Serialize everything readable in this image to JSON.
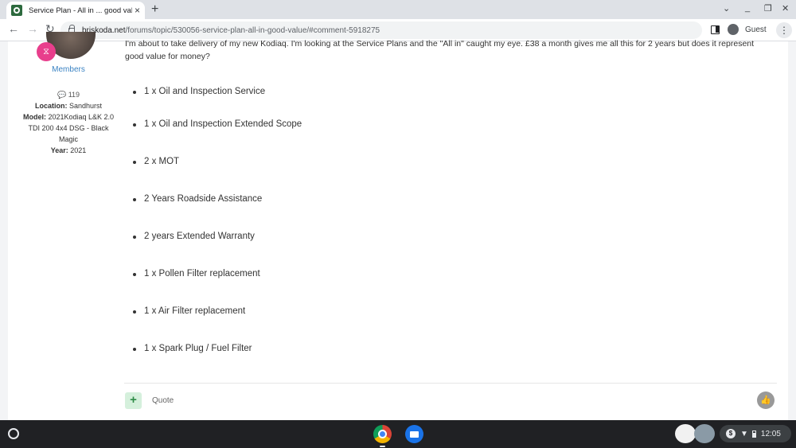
{
  "browser": {
    "tab_title": "Service Plan - All in ... good value",
    "tab_close": "×",
    "new_tab": "+",
    "url_host": "briskoda.net",
    "url_path": "/forums/topic/530056-service-plan-all-in-good-value/#comment-5918275",
    "profile_label": "Guest",
    "menu_glyph": "⋮",
    "win_minimize": "_",
    "win_restore": "❐",
    "win_close": "✕",
    "win_chevron": "⌄"
  },
  "author": {
    "group": "Members",
    "post_count": "119",
    "location_label": "Location:",
    "location": "Sandhurst",
    "model_label": "Model:",
    "model": "2021Kodiaq L&K 2.0 TDI 200 4x4 DSG - Black Magic",
    "year_label": "Year:",
    "year": "2021"
  },
  "post": {
    "intro": "I'm about to take delivery of my new Kodiaq. I'm looking at the Service Plans and the \"All in\" caught my eye. £38 a month gives me all this for 2 years but does it represent good value for money?",
    "items": [
      "1 x Oil and Inspection Service",
      "1 x Oil and Inspection Extended Scope",
      "2 x MOT",
      "2 Years Roadside Assistance",
      "2 years Extended Warranty",
      "1 x Pollen Filter replacement",
      "1 x Air Filter replacement",
      "1 x Spark Plug / Fuel Filter"
    ],
    "quote_label": "Quote",
    "plus_label": "+"
  },
  "taskbar": {
    "clock": "12:05",
    "tray_dollar": "$"
  },
  "colors": {
    "members_blue": "#3b83c3",
    "badge_pink": "#e83e8c",
    "taskbar": "#202124"
  }
}
